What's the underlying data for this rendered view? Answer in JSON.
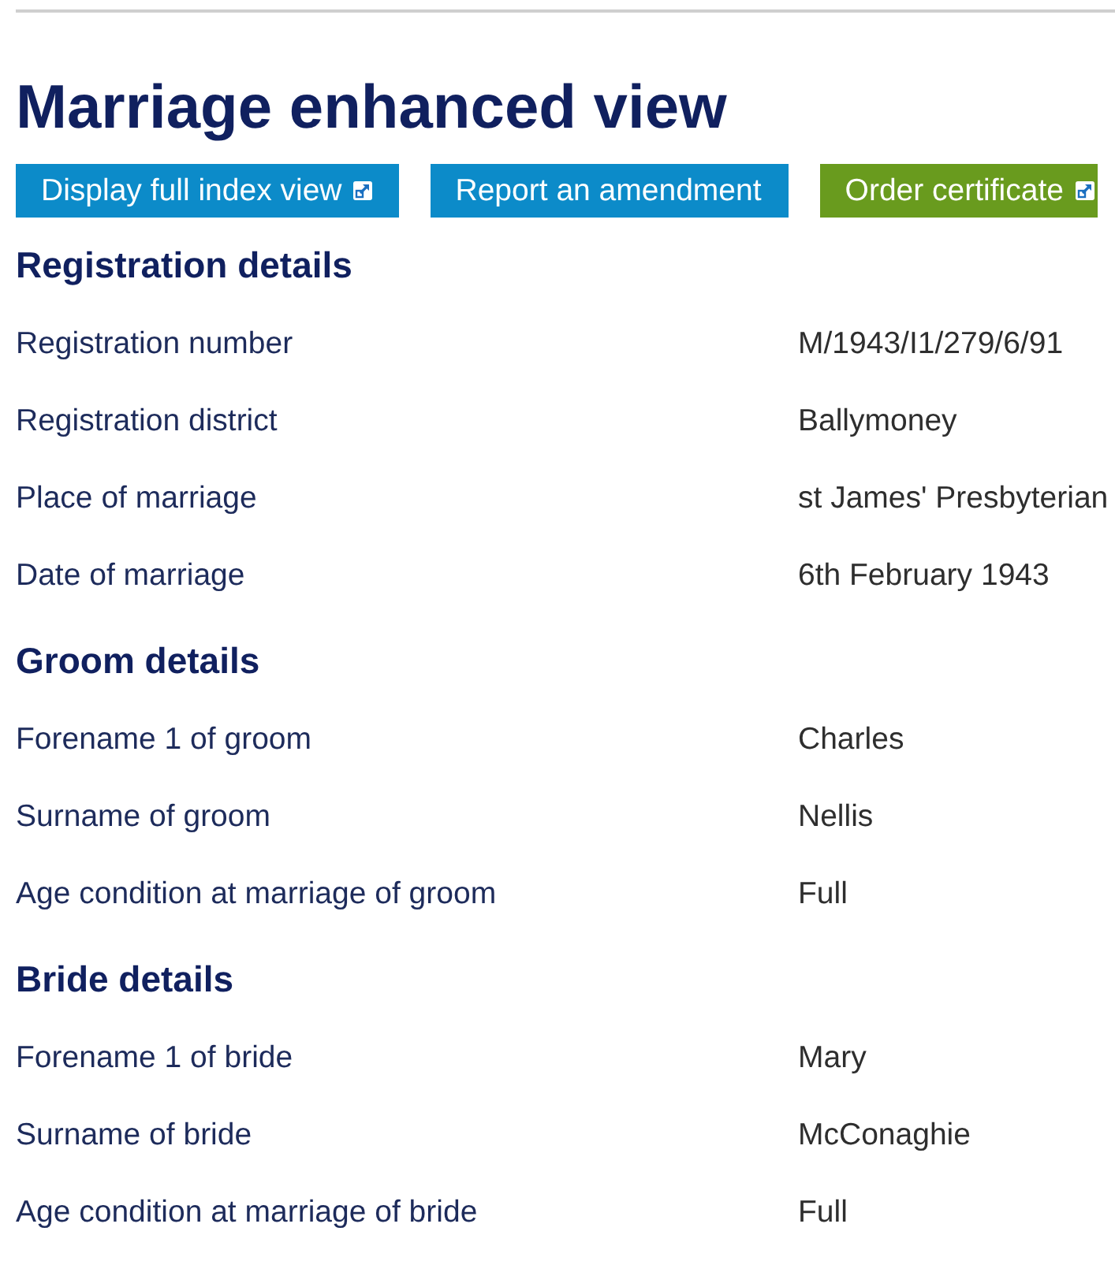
{
  "page": {
    "title": "Marriage enhanced view"
  },
  "actions": [
    {
      "label": "Display full index view",
      "color": "#0c8bc9",
      "external": true
    },
    {
      "label": "Report an amendment",
      "color": "#0c8bc9",
      "external": false
    },
    {
      "label": "Order certificate",
      "color": "#699b1e",
      "external": true
    }
  ],
  "sections": [
    {
      "heading": "Registration details",
      "rows": [
        {
          "label": "Registration number",
          "value": "M/1943/I1/279/6/91"
        },
        {
          "label": "Registration district",
          "value": "Ballymoney"
        },
        {
          "label": "Place of marriage",
          "value": "st James' Presbyterian"
        },
        {
          "label": "Date of marriage",
          "value": "6th February 1943"
        }
      ]
    },
    {
      "heading": "Groom details",
      "rows": [
        {
          "label": "Forename 1 of groom",
          "value": "Charles"
        },
        {
          "label": "Surname of groom",
          "value": "Nellis"
        },
        {
          "label": "Age condition at marriage of groom",
          "value": "Full"
        }
      ]
    },
    {
      "heading": "Bride details",
      "rows": [
        {
          "label": "Forename 1 of bride",
          "value": "Mary"
        },
        {
          "label": "Surname of bride",
          "value": "McConaghie"
        },
        {
          "label": "Age condition at marriage of bride",
          "value": "Full"
        }
      ]
    }
  ]
}
